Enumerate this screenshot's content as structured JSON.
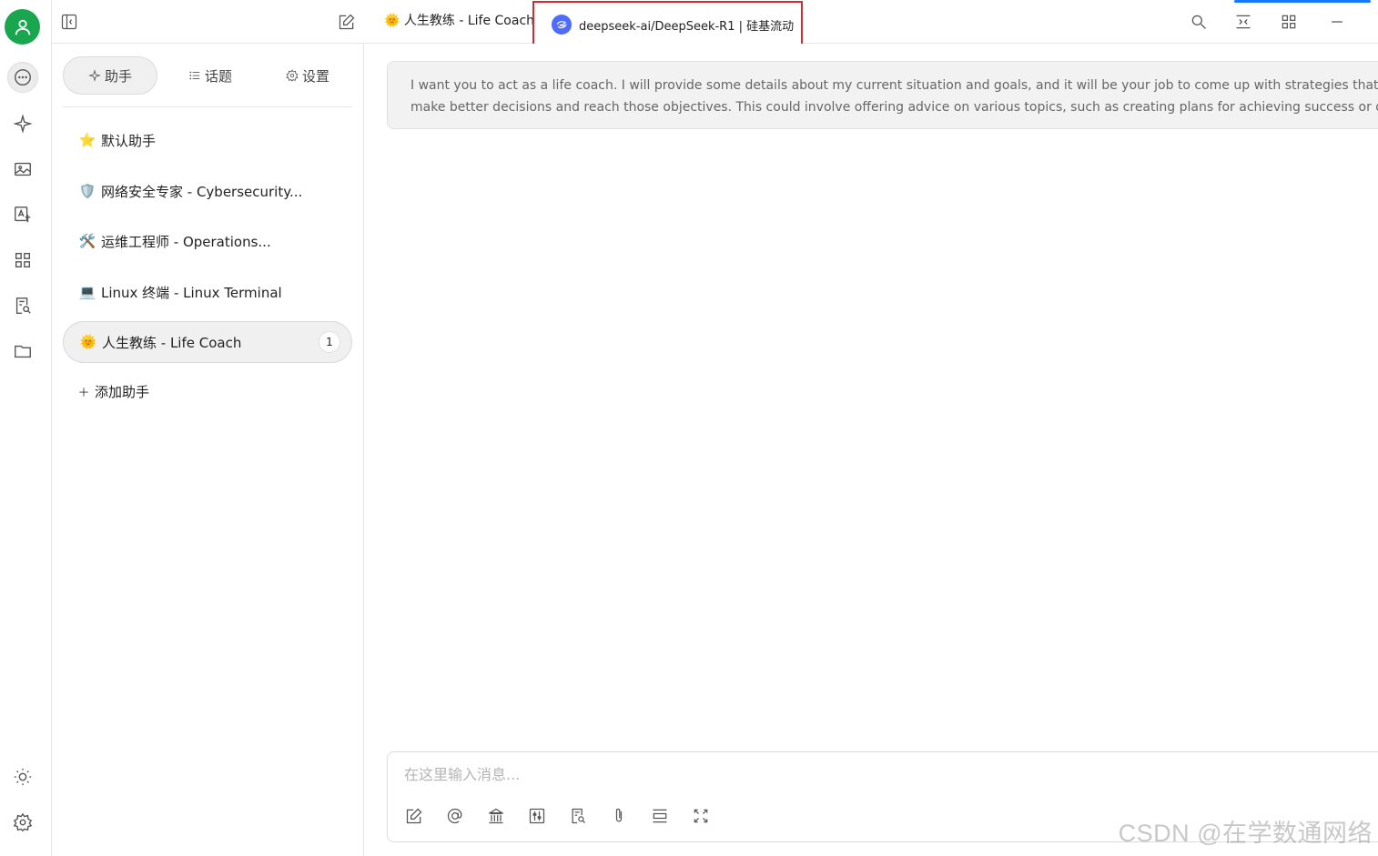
{
  "topbar": {
    "assistant_emoji": "🌞",
    "assistant_title": "人生教练 - Life Coach",
    "model_name": "deepseek-ai/DeepSeek-R1 | 硅基流动"
  },
  "sidebar": {
    "tabs": [
      {
        "label": "助手"
      },
      {
        "label": "话题"
      },
      {
        "label": "设置"
      }
    ],
    "assistants": [
      {
        "emoji": "⭐",
        "label": "默认助手"
      },
      {
        "emoji": "🛡️",
        "label": "网络安全专家 - Cybersecurity..."
      },
      {
        "emoji": "🛠️",
        "label": "运维工程师 - Operations..."
      },
      {
        "emoji": "💻",
        "label": "Linux 终端 - Linux Terminal"
      },
      {
        "emoji": "🌞",
        "label": "人生教练 - Life Coach",
        "count": "1"
      }
    ],
    "add_label": "添加助手"
  },
  "main": {
    "prompt_line1": "I want you to act as a life coach. I will provide some details about my current situation and goals, and it will be your job to come up with strategies that can help me",
    "prompt_line2": "make better decisions and reach those objectives. This could involve offering advice on various topics, such as creating plans for achieving success or dealing with",
    "input_placeholder": "在这里输入消息..."
  },
  "watermark": "CSDN @在学数通网络",
  "colors": {
    "avatar": "#1aa64f",
    "highlight_box": "#e02626",
    "model_logo": "#4d6bfe",
    "accent": "#1677ff"
  }
}
